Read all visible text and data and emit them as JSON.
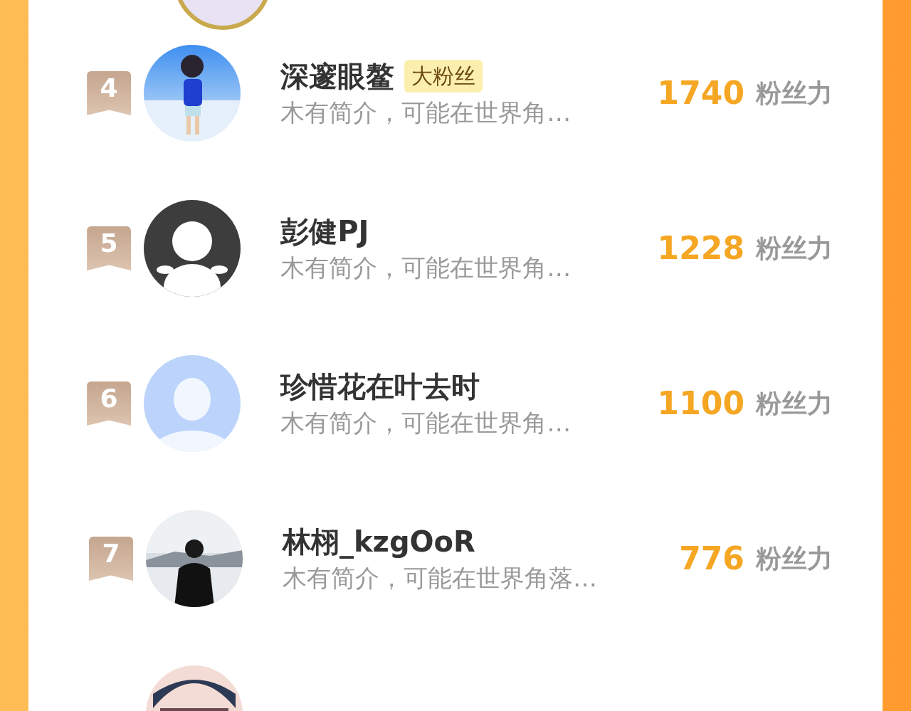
{
  "rows": [
    {
      "rank": "4",
      "name": "深邃眼鳌",
      "badge": "大粉丝",
      "bio": "木有简介，可能在世界角…",
      "score": "1740",
      "unit": "粉丝力",
      "avatar": {
        "kind": "sky"
      }
    },
    {
      "rank": "5",
      "name": "彭健PJ",
      "bio": "木有简介，可能在世界角…",
      "score": "1228",
      "unit": "粉丝力",
      "avatar": {
        "kind": "silhouette"
      }
    },
    {
      "rank": "6",
      "name": "珍惜花在叶去时",
      "bio": "木有简介，可能在世界角…",
      "score": "1100",
      "unit": "粉丝力",
      "avatar": {
        "kind": "default"
      }
    },
    {
      "rank": "7",
      "name": "林栩_kzgOoR",
      "bio": "木有简介，可能在世界角落…",
      "score": "776",
      "unit": "粉丝力",
      "avatar": {
        "kind": "snow"
      }
    },
    {
      "avatar": {
        "kind": "dark"
      }
    }
  ]
}
